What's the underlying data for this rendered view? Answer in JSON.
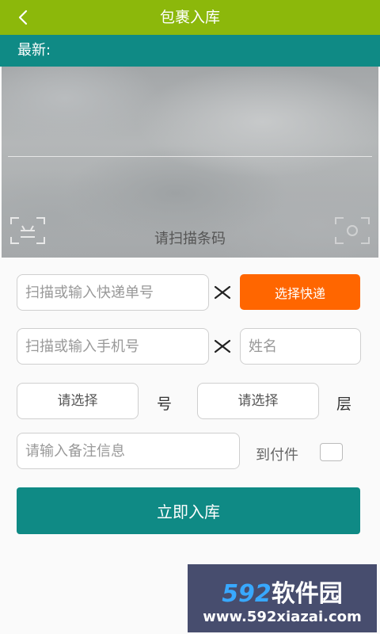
{
  "header": {
    "title": "包裹入库",
    "back_icon": "chevron-left-icon"
  },
  "latest_bar": {
    "label": "最新:"
  },
  "scanner": {
    "hint": "请扫描条码"
  },
  "form": {
    "tracking_number": {
      "value": "",
      "placeholder": "扫描或输入快递单号"
    },
    "select_express_label": "选择快递",
    "phone": {
      "value": "",
      "placeholder": "扫描或输入手机号"
    },
    "name": {
      "value": "",
      "placeholder": "姓名"
    },
    "number_select": {
      "value": "请选择",
      "unit": "号"
    },
    "floor_select": {
      "value": "请选择",
      "unit": "层"
    },
    "note": {
      "value": "",
      "placeholder": "请输入备注信息"
    },
    "cash_on_delivery": {
      "label": "到付件",
      "checked": false
    },
    "submit_label": "立即入库"
  },
  "watermark": {
    "logo_number": "592",
    "logo_text": "软件园",
    "url": "www.592xiazai.com"
  },
  "colors": {
    "header_bg": "#8cb80b",
    "accent_teal": "#0f8a85",
    "express_button": "#ff6600"
  }
}
